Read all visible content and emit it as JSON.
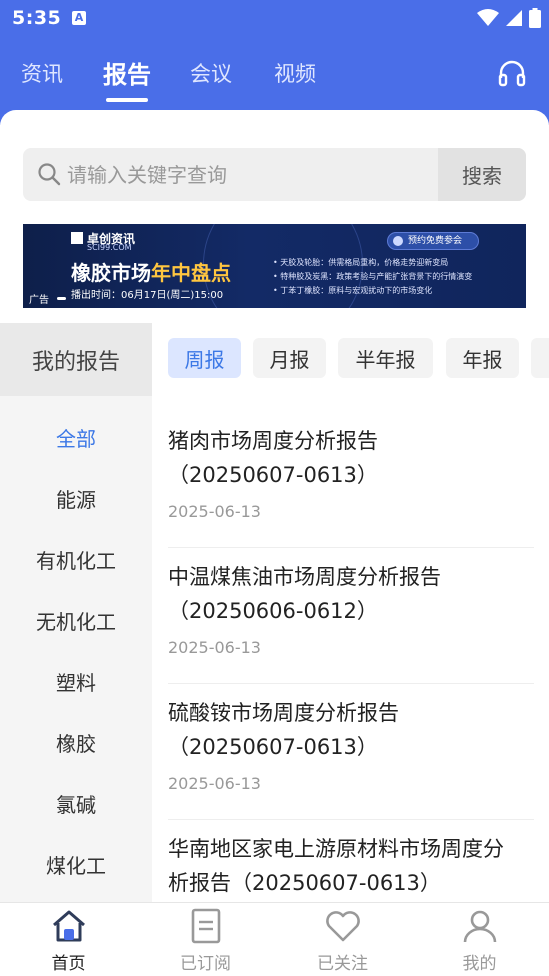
{
  "status_bar": {
    "time": "5:35",
    "notif_letter": "A"
  },
  "nav_tabs": [
    {
      "label": "资讯"
    },
    {
      "label": "报告"
    },
    {
      "label": "会议"
    },
    {
      "label": "视频"
    }
  ],
  "active_tab": "报告",
  "search": {
    "placeholder": "请输入关键字查询",
    "value": "",
    "button_label": "搜索"
  },
  "banner": {
    "brand": "卓创资讯",
    "brand_sub": "SCI99.COM",
    "title_main": "橡胶市场",
    "title_highlight": "年中盘点",
    "broadcast_time": "播出时间：06月17日(周二)15:00",
    "ad_label": "广告",
    "cta": "预约免费参会",
    "bullets": [
      "• 天胶及轮胎：供需格局重构，价格走势迎新变局",
      "• 特种胶及炭黑：政策考验与产能扩张背景下的行情演变",
      "• 丁苯丁橡胶：原料与宏观扰动下的市场变化"
    ]
  },
  "sidebar": {
    "header": "我的报告",
    "items": [
      {
        "label": "全部"
      },
      {
        "label": "能源"
      },
      {
        "label": "有机化工"
      },
      {
        "label": "无机化工"
      },
      {
        "label": "塑料"
      },
      {
        "label": "橡胶"
      },
      {
        "label": "氯碱"
      },
      {
        "label": "煤化工"
      }
    ]
  },
  "period_tabs": [
    {
      "label": "周报"
    },
    {
      "label": "月报"
    },
    {
      "label": "半年报"
    },
    {
      "label": "年报"
    }
  ],
  "reports": [
    {
      "title_line1": "猪肉市场周度分析报告",
      "title_line2": "（20250607-0613）",
      "date": "2025-06-13"
    },
    {
      "title_line1": "中温煤焦油市场周度分析报告",
      "title_line2": "（20250606-0612）",
      "date": "2025-06-13"
    },
    {
      "title_line1": "硫酸铵市场周度分析报告",
      "title_line2": "（20250607-0613）",
      "date": "2025-06-13"
    },
    {
      "title_line1": "华南地区家电上游原材料市场周度分",
      "title_line2": "析报告（20250607-0613）",
      "date": ""
    }
  ],
  "bottom_nav": [
    {
      "label": "首页",
      "icon": "home-icon"
    },
    {
      "label": "已订阅",
      "icon": "document-icon"
    },
    {
      "label": "已关注",
      "icon": "heart-icon"
    },
    {
      "label": "我的",
      "icon": "user-icon"
    }
  ],
  "colors": {
    "header_blue": "#4a6ee8",
    "accent_blue": "#3c78e6",
    "chip_active_bg": "#dce6ff"
  }
}
